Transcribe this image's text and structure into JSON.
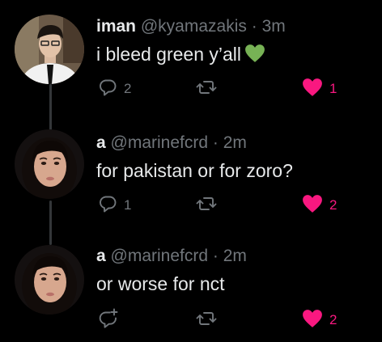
{
  "colors": {
    "background": "#000000",
    "text": "#e7e9ea",
    "muted": "#71767b",
    "like": "#f91880",
    "thread_line": "#333639",
    "emoji_heart": "#77b255"
  },
  "tweets": [
    {
      "name": "iman",
      "handle": "@kyamazakis",
      "separator": "·",
      "time": "3m",
      "text": "i bleed green y’all",
      "emoji": "green-heart",
      "reply_icon": "reply-icon",
      "reply_count": "2",
      "retweet_icon": "retweet-icon",
      "like_icon": "heart-filled-icon",
      "like_count": "1"
    },
    {
      "name": "a",
      "handle": "@marinefcrd",
      "separator": "·",
      "time": "2m",
      "text": "for pakistan or for zoro?",
      "reply_icon": "reply-icon",
      "reply_count": "1",
      "retweet_icon": "retweet-icon",
      "like_icon": "heart-filled-icon",
      "like_count": "2"
    },
    {
      "name": "a",
      "handle": "@marinefcrd",
      "separator": "·",
      "time": "2m",
      "text": "or worse for nct",
      "reply_icon": "reply-plus-icon",
      "reply_count": "",
      "retweet_icon": "retweet-icon",
      "like_icon": "heart-filled-icon",
      "like_count": "2"
    }
  ]
}
